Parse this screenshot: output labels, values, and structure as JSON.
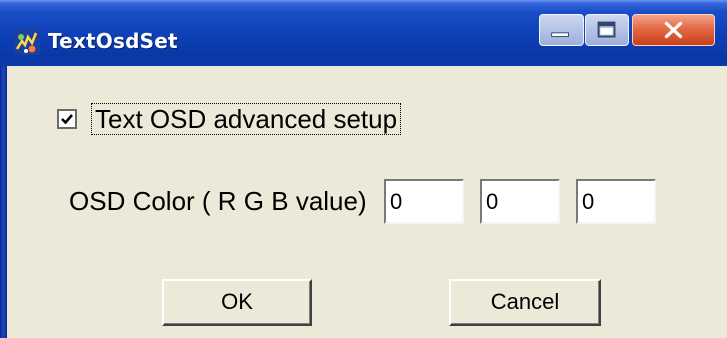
{
  "window": {
    "title": "TextOsdSet",
    "icon": "app-icon"
  },
  "title_buttons": {
    "minimize_icon": "minimize-icon",
    "maximize_icon": "maximize-icon",
    "close_icon": "close-icon"
  },
  "advanced": {
    "label": "Text OSD advanced setup",
    "checked": true
  },
  "osd_color": {
    "label": "OSD Color ( R G B value)",
    "r": "0",
    "g": "0",
    "b": "0"
  },
  "buttons": {
    "ok": "OK",
    "cancel": "Cancel"
  },
  "colors": {
    "titlebar": "#0d3fb5",
    "close_button": "#e46a45",
    "client_background": "#ece9d8"
  }
}
